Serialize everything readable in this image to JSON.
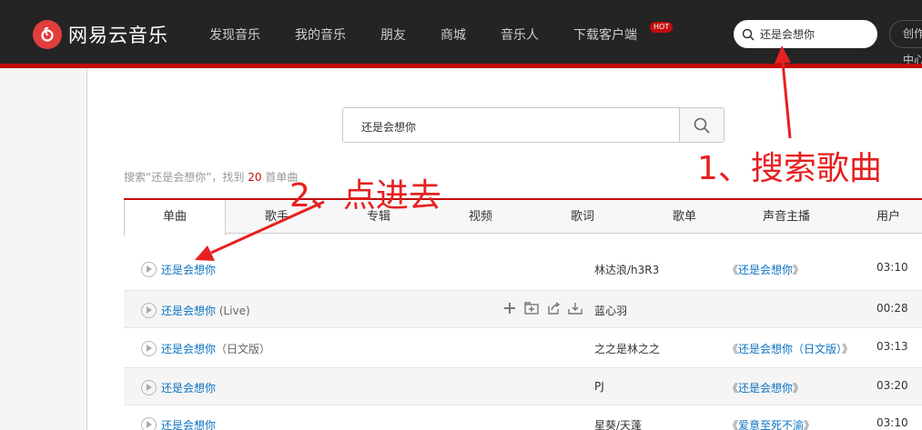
{
  "header": {
    "logo_text": "网易云音乐",
    "nav": [
      "发现音乐",
      "我的音乐",
      "朋友",
      "商城",
      "音乐人",
      "下载客户端"
    ],
    "hot_badge": "HOT",
    "search_value": "还是会想你",
    "creator_label": "创作者中心"
  },
  "search": {
    "value": "还是会想你"
  },
  "result_info": {
    "prefix": "搜索“还是会想你”，找到 ",
    "count": "20",
    "suffix": " 首单曲"
  },
  "tabs": [
    "单曲",
    "歌手",
    "专辑",
    "视频",
    "歌词",
    "歌单",
    "声音主播",
    "用户"
  ],
  "songs": [
    {
      "title": "还是会想你",
      "sub": "",
      "artist": "林达浪/h3R3",
      "album": "还是会想你",
      "duration": "03:10"
    },
    {
      "title": "还是会想你",
      "sub": " (Live)",
      "artist": "蓝心羽",
      "album": "",
      "duration": "00:28"
    },
    {
      "title": "还是会想你",
      "sub": "（日文版）",
      "artist": "之之是林之之",
      "album": "还是会想你（日文版）",
      "duration": "03:13"
    },
    {
      "title": "还是会想你",
      "sub": "",
      "artist": "PJ",
      "album": "还是会想你",
      "duration": "03:20"
    },
    {
      "title": "还是会想你",
      "sub": "",
      "artist": "星葵/天蓬",
      "album": "爱意至死不渝",
      "duration": "03:10"
    }
  ],
  "annotations": {
    "step1": "1、搜索歌曲",
    "step2": "2、点进去"
  },
  "colors": {
    "brand_red": "#c20c0c",
    "link_blue": "#0c73c2",
    "annotation_red": "#e62020"
  }
}
